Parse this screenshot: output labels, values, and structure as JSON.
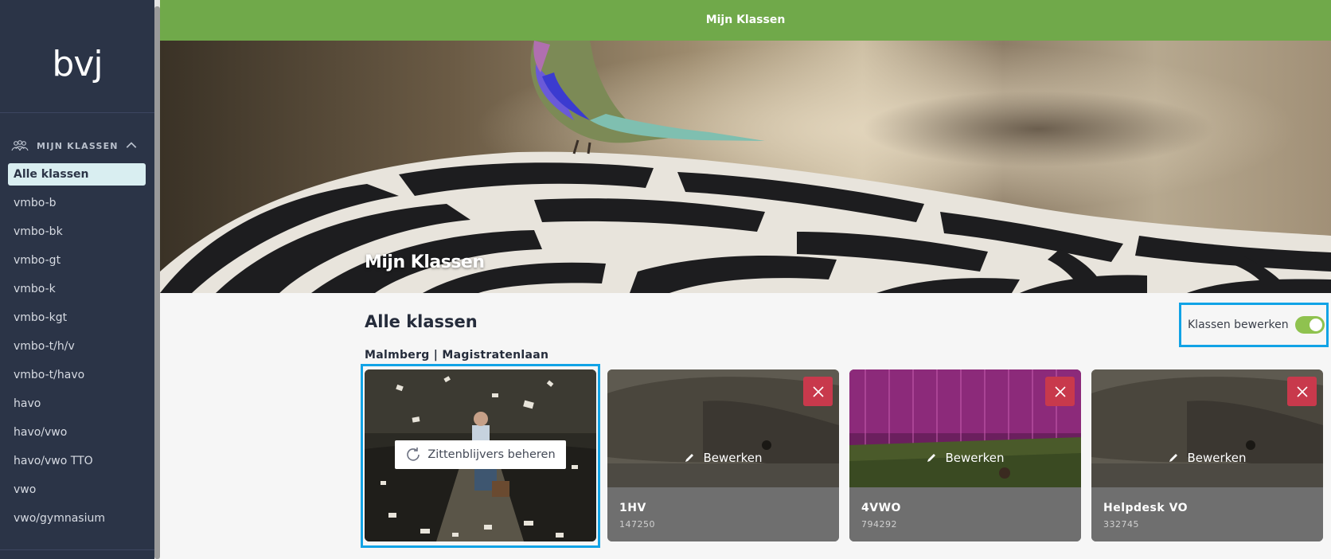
{
  "app": {
    "logo_text": "bvj",
    "topbar_title": "Mijn Klassen"
  },
  "sidebar": {
    "section_label": "MIJN KLASSEN",
    "items": [
      {
        "label": "Alle klassen",
        "active": true
      },
      {
        "label": "vmbo-b"
      },
      {
        "label": "vmbo-bk"
      },
      {
        "label": "vmbo-gt"
      },
      {
        "label": "vmbo-k"
      },
      {
        "label": "vmbo-kgt"
      },
      {
        "label": "vmbo-t/h/v"
      },
      {
        "label": "vmbo-t/havo"
      },
      {
        "label": "havo"
      },
      {
        "label": "havo/vwo"
      },
      {
        "label": "havo/vwo TTO"
      },
      {
        "label": "vwo"
      },
      {
        "label": "vwo/gymnasium"
      }
    ]
  },
  "hero": {
    "title": "Mijn Klassen"
  },
  "main": {
    "title": "Alle klassen",
    "edit_toggle_label": "Klassen bewerken",
    "edit_toggle_on": true,
    "school_label": "Malmberg | Magistratenlaan",
    "repeaters_button_label": "Zittenblijvers beheren",
    "edit_button_label": "Bewerken",
    "classes": [
      {
        "name": "1HV",
        "code": "147250",
        "image": "boar"
      },
      {
        "name": "4VWO",
        "code": "794292",
        "image": "greenhouse"
      },
      {
        "name": "Helpdesk VO",
        "code": "332745",
        "image": "boar"
      }
    ]
  },
  "colors": {
    "sidebar_bg": "#2b3447",
    "topbar_bg": "#70a94a",
    "highlight_border": "#11a3e6",
    "delete_red": "#c8394c",
    "toggle_green": "#8fc24f"
  }
}
